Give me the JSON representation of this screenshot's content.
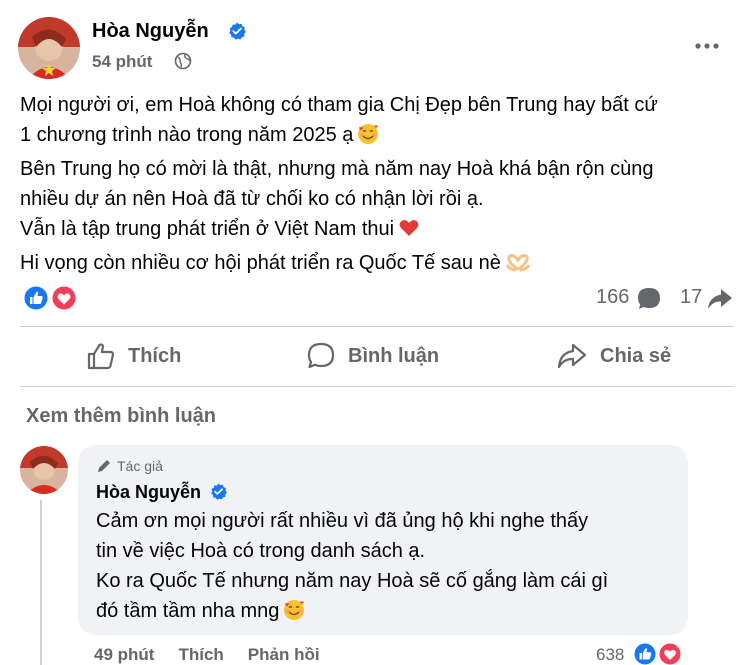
{
  "post": {
    "author": "Hòa Nguyễn",
    "time": "54 phút",
    "lines": [
      "Mọi người ơi, em Hoà không có tham gia Chị Đẹp bên Trung hay bất cứ",
      "1 chương trình nào trong năm 2025 ạ",
      "Bên Trung họ có mời là thật, nhưng mà năm nay Hoà khá bận rộn cùng",
      "nhiều dự án nên Hoà đã từ chối ko có nhận lời rồi ạ.",
      "Vẫn là tập trung phát triển ở Việt Nam thui",
      "Hi vọng còn nhiều cơ hội phát triển ra Quốc Tế sau nè"
    ],
    "comment_count": "166",
    "share_count": "17"
  },
  "actions": {
    "like": "Thích",
    "comment": "Bình luận",
    "share": "Chia sẻ"
  },
  "see_more": "Xem thêm bình luận",
  "comment": {
    "badge": "Tác giả",
    "author": "Hòa Nguyễn",
    "lines": [
      "Cảm ơn mọi người rất nhiều vì đã ủng hộ khi nghe thấy",
      "tin về việc Hoà có trong danh sách ạ.",
      "Ko ra Quốc Tế nhưng năm nay Hoà sẽ cố gắng làm cái gì",
      "đó tầm tầm nha mng"
    ],
    "time": "49 phút",
    "like": "Thích",
    "reply": "Phản hồi",
    "reaction_count": "638"
  },
  "icons": {
    "verified": "verified-badge-icon",
    "globe": "globe-icon",
    "more": "more-dots-icon",
    "like_reaction": "like-reaction-icon",
    "love_reaction": "love-reaction-icon",
    "comment": "comment-bubble-icon",
    "share": "share-arrow-icon",
    "pencil": "pencil-icon"
  },
  "colors": {
    "facebook_blue": "#1877f2",
    "love_red": "#f33e58",
    "secondary_text": "#65676b"
  }
}
